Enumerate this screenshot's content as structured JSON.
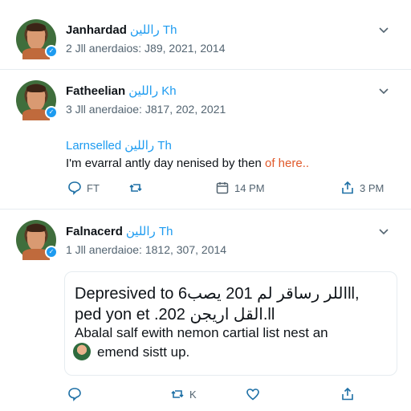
{
  "colors": {
    "accent": "#1d9bf0",
    "highlight": "#e0592a",
    "muted": "#536471",
    "border": "#e6ecf0"
  },
  "tweets": [
    {
      "name": "Janhardad",
      "handle_suffix": "ﺭﺍﻟﻠﻴﻦ Th",
      "meta": "2 Jll anerdaios: J89, 2021, 2014"
    },
    {
      "name": "Fatheelian",
      "handle_suffix": "ﺭﺍﻟﻠﻴﻦ Kh",
      "meta": "3 Jll anerdaioe: J817, 202, 2021",
      "reply_to_name": "Larnselled",
      "reply_to_suffix": "ﺭﺍﻟﻠﻴﻦ Th",
      "text_main": "I'm evarral antly day nenised by then ",
      "text_highlight": "of here..",
      "actions": {
        "reply": "FT",
        "retweet": "",
        "schedule": "14 PM",
        "share": "3 PM"
      }
    },
    {
      "name": "Falnacerd",
      "handle_suffix": "ﺭﺍﻟﻠﻴﻦ Th",
      "meta": "1 Jll anerdaioe: 1812, 307, 2014",
      "card": {
        "line1": "Depresived to ﺍﻟﻠﺮ ﺭﺳﺎﻗﺮ ﻟﻢ 201 ﻳﺼﺐ6ll,",
        "line2": "ped yon et .202 ﺍﻟﻘﻞ ﺍﺭﻳﺠﻦ.ll",
        "line3": "Abalal salf ewith nemon cartial list nest an",
        "line4": "emend sistt up."
      },
      "actions": {
        "reply": "",
        "retweet": "K",
        "like": "",
        "share": ""
      }
    }
  ],
  "icons": {
    "chevron": "chevron-down-icon",
    "verified": "verified-badge-icon",
    "reply": "reply-bubble-icon",
    "retweet": "retweet-icon",
    "calendar": "calendar-icon",
    "share": "share-icon",
    "like": "heart-icon"
  }
}
